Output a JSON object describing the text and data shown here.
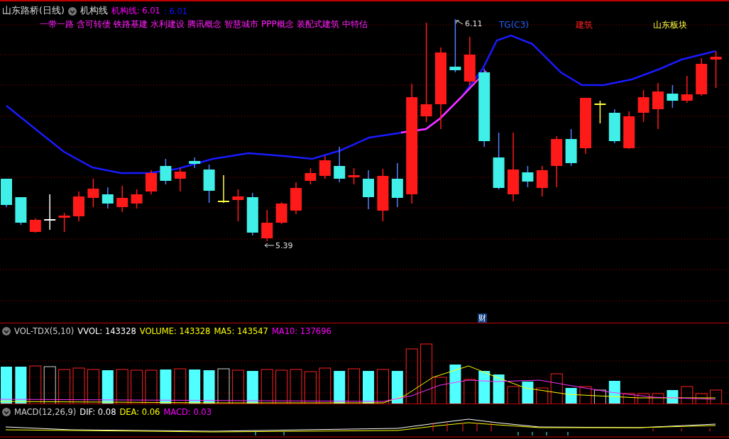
{
  "header": {
    "title": "山东路桥(日线)",
    "indicator": "机构线",
    "values": [
      {
        "text": "机构线: 6.01",
        "color": "#ff00ff"
      },
      {
        "text": ": 6.01",
        "color": "#1414ff"
      }
    ]
  },
  "concepts": [
    "一带一路",
    "含可转债",
    "铁路基建",
    "水利建设",
    "腾讯概念",
    "智慧城市",
    "PPP概念",
    "装配式建筑",
    "中特估"
  ],
  "price_marks": {
    "high": "6.11",
    "low": "5.39"
  },
  "chart_labels": [
    {
      "text": "TG(C3)",
      "color": "#2060ff"
    },
    {
      "text": "建筑",
      "color": "#ff2020"
    },
    {
      "text": "山东板块",
      "color": "#ffff40"
    }
  ],
  "event_badge": "财",
  "volume_legend": [
    {
      "text": "VOL-TDX(5,10)",
      "color": "#d0d0d0"
    },
    {
      "text": "VVOL: 143328",
      "color": "#ffffff"
    },
    {
      "text": "VOLUME: 143328",
      "color": "#ffff00"
    },
    {
      "text": "MA5: 143547",
      "color": "#ffff00"
    },
    {
      "text": "MA10: 137696",
      "color": "#ff00ff"
    }
  ],
  "macd_legend": [
    {
      "text": "MACD(12,26,9)",
      "color": "#d0d0d0"
    },
    {
      "text": "DIF: 0.08",
      "color": "#ffffff"
    },
    {
      "text": "DEA: 0.06",
      "color": "#ffff00"
    },
    {
      "text": "MACD: 0.03",
      "color": "#ff00ff"
    }
  ]
}
